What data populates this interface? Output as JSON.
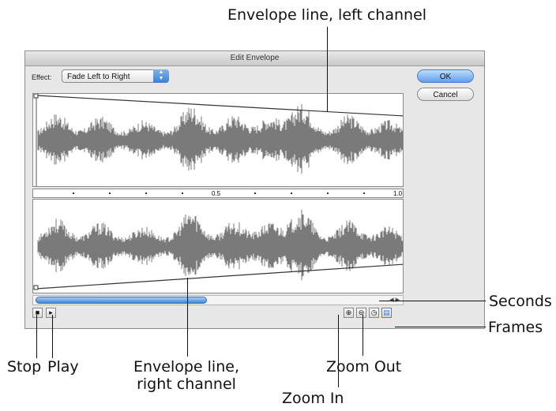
{
  "callouts": {
    "envelope_left": "Envelope line, left channel",
    "seconds": "Seconds",
    "frames": "Frames",
    "stop": "Stop",
    "play": "Play",
    "envelope_right_line1": "Envelope line,",
    "envelope_right_line2": "right channel",
    "zoom_out": "Zoom Out",
    "zoom_in": "Zoom In"
  },
  "dialog": {
    "title": "Edit Envelope",
    "effect_label": "Effect:",
    "effect_value": "Fade Left to Right",
    "ok_label": "OK",
    "cancel_label": "Cancel"
  },
  "ruler": {
    "mid_label": "0.5",
    "end_label": "1.0"
  },
  "toolbar": {
    "stop_icon": "stop-icon",
    "play_icon": "play-icon",
    "zoom_in_icon": "zoom-in-icon",
    "zoom_out_icon": "zoom-out-icon",
    "seconds_icon": "clock-icon",
    "frames_icon": "frames-icon"
  },
  "envelope": {
    "left_channel_level": [
      1.0,
      0.0
    ],
    "right_channel_level": [
      0.0,
      1.0
    ]
  },
  "colors": {
    "dialog_bg": "#e7e7e7",
    "accent": "#3f86d8",
    "waveform": "#7a7a7a"
  }
}
